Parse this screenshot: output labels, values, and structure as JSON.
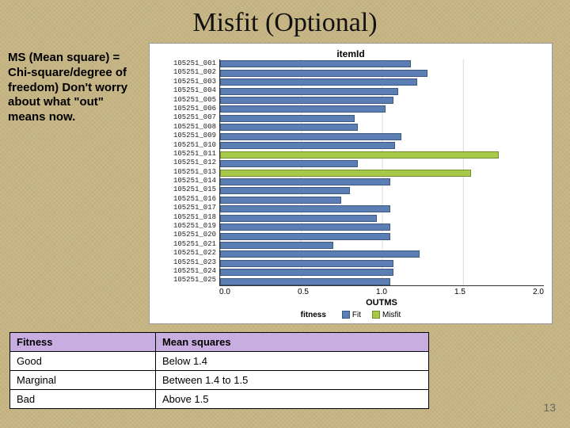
{
  "title": "Misfit (Optional)",
  "side_text": "MS (Mean square) = Chi-square/degree of freedom) Don't worry about what \"out\" means now.",
  "page_number": "13",
  "table": {
    "headers": [
      "Fitness",
      "Mean squares"
    ],
    "rows": [
      [
        "Good",
        "Below 1.4"
      ],
      [
        "Marginal",
        "Between 1.4 to 1.5"
      ],
      [
        "Bad",
        "Above 1.5"
      ]
    ]
  },
  "legend": {
    "title": "fitness",
    "items": [
      "Fit",
      "Misfit"
    ]
  },
  "chart_data": {
    "type": "bar",
    "title": "itemId",
    "xlabel": "OUTMS",
    "ylabel": "",
    "xlim": [
      0.0,
      2.0
    ],
    "ticks": [
      "0.0",
      "0.5",
      "1.0",
      "1.5",
      "2.0"
    ],
    "categories": [
      "105251_001",
      "105251_002",
      "105251_003",
      "105251_004",
      "105251_005",
      "105251_006",
      "105251_007",
      "105251_008",
      "105251_009",
      "105251_010",
      "105251_011",
      "105251_012",
      "105251_013",
      "105251_014",
      "105251_015",
      "105251_016",
      "105251_017",
      "105251_018",
      "105251_019",
      "105251_020",
      "105251_021",
      "105251_022",
      "105251_023",
      "105251_024",
      "105251_025"
    ],
    "series": [
      {
        "name": "Fit",
        "values": [
          1.18,
          1.28,
          1.22,
          1.1,
          1.07,
          1.02,
          0.83,
          0.85,
          1.12,
          1.08,
          null,
          0.85,
          null,
          1.05,
          0.8,
          0.75,
          1.05,
          0.97,
          1.05,
          1.05,
          0.7,
          1.23,
          1.07,
          1.07,
          1.05
        ]
      },
      {
        "name": "Misfit",
        "values": [
          null,
          null,
          null,
          null,
          null,
          null,
          null,
          null,
          null,
          null,
          1.72,
          null,
          1.55,
          null,
          null,
          null,
          null,
          null,
          null,
          null,
          null,
          null,
          null,
          null,
          null
        ]
      }
    ]
  }
}
